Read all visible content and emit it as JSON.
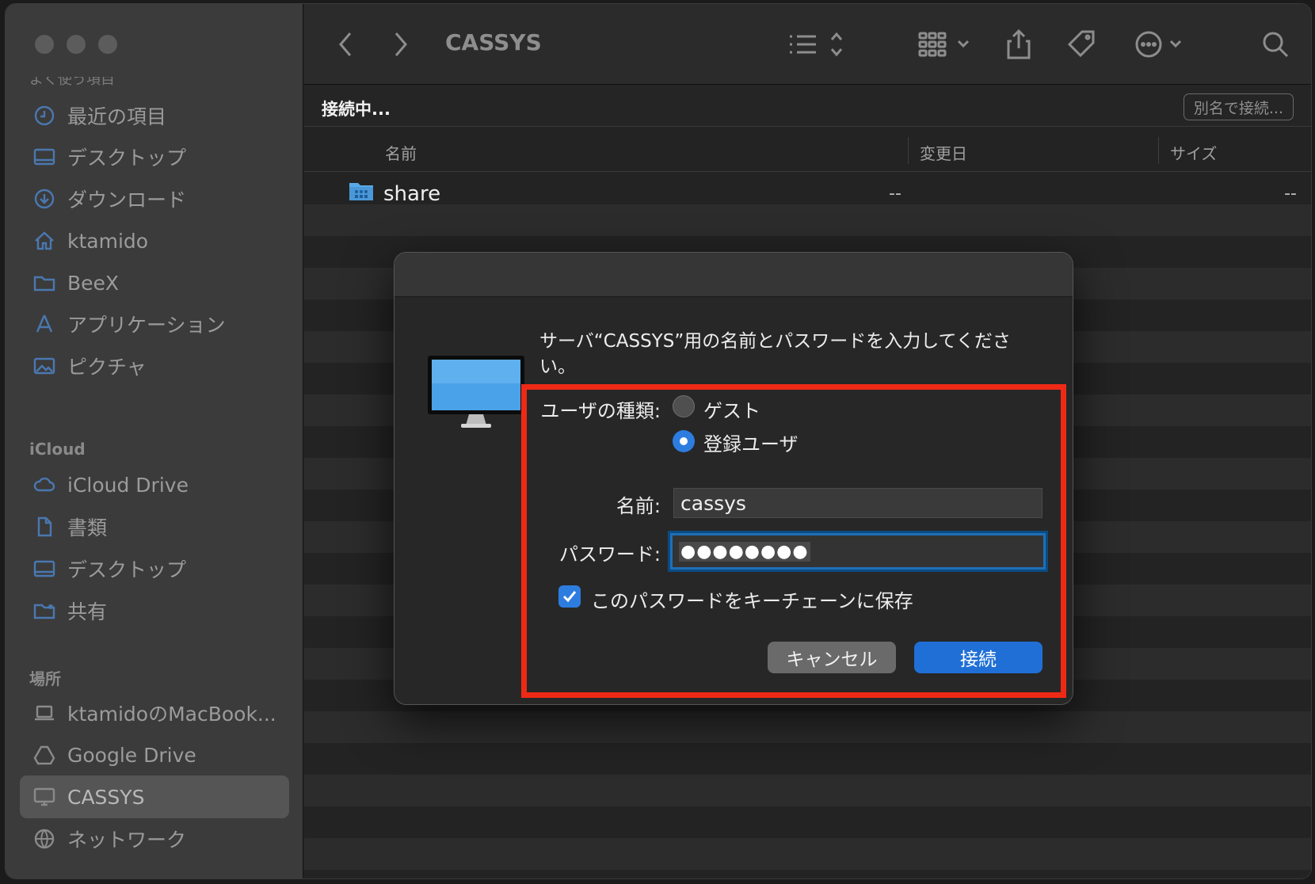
{
  "window": {
    "title": "CASSYS"
  },
  "sidebar": {
    "cut_section": "よく使う項目",
    "favorites": [
      {
        "label": "最近の項目",
        "icon": "clock-icon"
      },
      {
        "label": "デスクトップ",
        "icon": "desktop-icon"
      },
      {
        "label": "ダウンロード",
        "icon": "download-icon"
      },
      {
        "label": "ktamido",
        "icon": "home-icon"
      },
      {
        "label": "BeeX",
        "icon": "folder-icon"
      },
      {
        "label": "アプリケーション",
        "icon": "apps-icon"
      },
      {
        "label": "ピクチャ",
        "icon": "pictures-icon"
      }
    ],
    "icloud_title": "iCloud",
    "icloud": [
      {
        "label": "iCloud Drive",
        "icon": "cloud-icon"
      },
      {
        "label": "書類",
        "icon": "document-icon"
      },
      {
        "label": "デスクトップ",
        "icon": "desktop-icon"
      },
      {
        "label": "共有",
        "icon": "shared-folder-icon"
      }
    ],
    "locations_title": "場所",
    "locations": [
      {
        "label": "ktamidoのMacBook...",
        "icon": "laptop-icon"
      },
      {
        "label": "Google Drive",
        "icon": "drive-icon"
      },
      {
        "label": "CASSYS",
        "icon": "server-icon",
        "selected": true
      },
      {
        "label": "ネットワーク",
        "icon": "globe-icon"
      }
    ]
  },
  "status": {
    "text": "接続中...",
    "alias_button": "別名で接続..."
  },
  "columns": {
    "name": "名前",
    "modified": "変更日",
    "size": "サイズ"
  },
  "files": [
    {
      "name": "share",
      "modified": "--",
      "size": "--"
    }
  ],
  "dialog": {
    "message": "サーバ“CASSYS”用の名前とパスワードを入力してください。",
    "user_type_label": "ユーザの種類:",
    "guest_label": "ゲスト",
    "registered_label": "登録ユーザ",
    "selected_user_type": "登録ユーザ",
    "name_label": "名前:",
    "name_value": "cassys",
    "password_label": "パスワード:",
    "password_value": "●●●●●●●●",
    "keychain_label": "このパスワードをキーチェーンに保存",
    "keychain_checked": true,
    "cancel_button": "キャンセル",
    "connect_button": "接続"
  },
  "colors": {
    "accent": "#1f6fd6",
    "highlight": "#ee2a16"
  }
}
